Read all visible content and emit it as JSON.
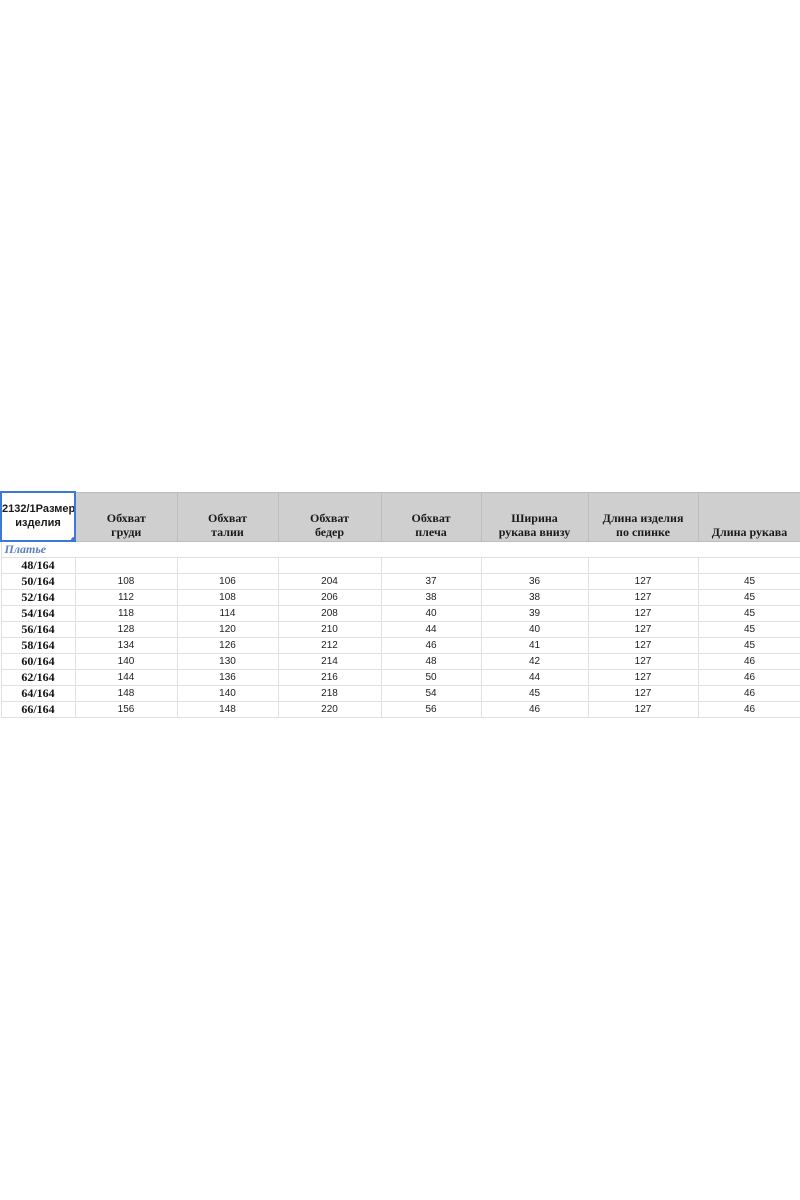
{
  "header": {
    "first_line1": "2132/1Размер",
    "first_line2": "изделия",
    "columns": [
      {
        "line1": "Обхват",
        "line2": "груди"
      },
      {
        "line1": "Обхват",
        "line2": "талии"
      },
      {
        "line1": "Обхват",
        "line2": "бедер"
      },
      {
        "line1": "Обхват",
        "line2": "плеча"
      },
      {
        "line1": "Ширина",
        "line2": "рукава внизу"
      },
      {
        "line1": "Длина изделия",
        "line2": "по спинке"
      },
      {
        "line1": "",
        "line2": "Длина рукава"
      }
    ]
  },
  "section_label": "Платье",
  "rows": [
    {
      "size": "48/164",
      "values": [
        "",
        "",
        "",
        "",
        "",
        "",
        ""
      ]
    },
    {
      "size": "50/164",
      "values": [
        "108",
        "106",
        "204",
        "37",
        "36",
        "127",
        "45"
      ]
    },
    {
      "size": "52/164",
      "values": [
        "112",
        "108",
        "206",
        "38",
        "38",
        "127",
        "45"
      ]
    },
    {
      "size": "54/164",
      "values": [
        "118",
        "114",
        "208",
        "40",
        "39",
        "127",
        "45"
      ]
    },
    {
      "size": "56/164",
      "values": [
        "128",
        "120",
        "210",
        "44",
        "40",
        "127",
        "45"
      ]
    },
    {
      "size": "58/164",
      "values": [
        "134",
        "126",
        "212",
        "46",
        "41",
        "127",
        "45"
      ]
    },
    {
      "size": "60/164",
      "values": [
        "140",
        "130",
        "214",
        "48",
        "42",
        "127",
        "46"
      ]
    },
    {
      "size": "62/164",
      "values": [
        "144",
        "136",
        "216",
        "50",
        "44",
        "127",
        "46"
      ]
    },
    {
      "size": "64/164",
      "values": [
        "148",
        "140",
        "218",
        "54",
        "45",
        "127",
        "46"
      ]
    },
    {
      "size": "66/164",
      "values": [
        "156",
        "148",
        "220",
        "56",
        "46",
        "127",
        "46"
      ]
    }
  ]
}
